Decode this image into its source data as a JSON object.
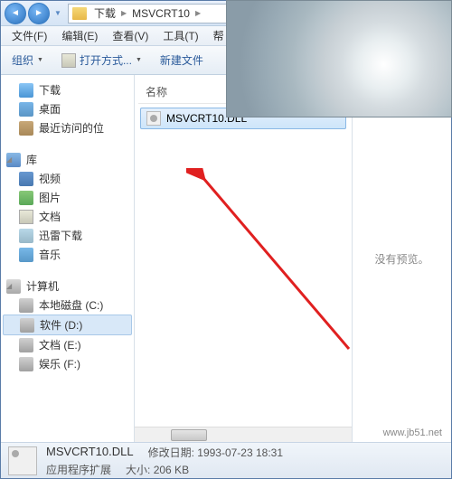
{
  "breadcrumb": {
    "seg1": "下载",
    "seg2": "MSVCRT10"
  },
  "menu": {
    "file": "文件(F)",
    "edit": "编辑(E)",
    "view": "查看(V)",
    "tools": "工具(T)",
    "help": "帮"
  },
  "toolbar": {
    "org": "组织",
    "open": "打开方式...",
    "new": "新建文件"
  },
  "sidebar": {
    "downloads": "下载",
    "desktop": "桌面",
    "recent": "最近访问的位",
    "libs": "库",
    "video": "视频",
    "pics": "图片",
    "docs": "文档",
    "xunlei": "迅雷下载",
    "music": "音乐",
    "computer": "计算机",
    "c": "本地磁盘 (C:)",
    "d": "软件 (D:)",
    "e": "文档 (E:)",
    "f": "娱乐 (F:)"
  },
  "cols": {
    "name": "名称"
  },
  "file": {
    "name": "MSVCRT10.DLL"
  },
  "preview": {
    "none": "没有预览。"
  },
  "status": {
    "filename": "MSVCRT10.DLL",
    "type": "应用程序扩展",
    "modlabel": "修改日期:",
    "moddate": "1993-07-23 18:31",
    "sizelabel": "大小:",
    "size": "206 KB"
  },
  "watermark": "www.jb51.net"
}
